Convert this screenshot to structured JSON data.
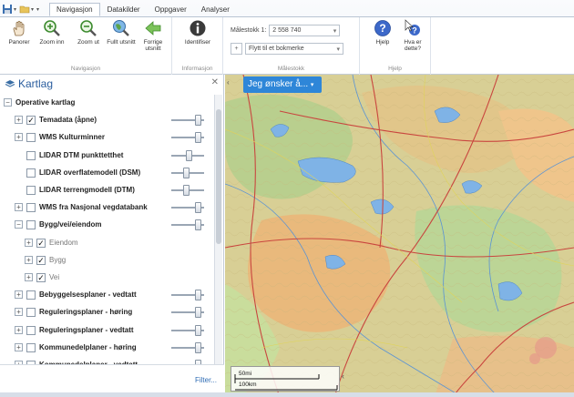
{
  "tabs": [
    "Navigasjon",
    "Datakilder",
    "Oppgaver",
    "Analyser"
  ],
  "ribbon": {
    "nav_buttons": [
      "Panorer",
      "Zoom inn",
      "Zoom ut",
      "Fullt utsnitt",
      "Forrige utsnitt"
    ],
    "nav_group": "Navigasjon",
    "info_button": "Identifiser",
    "info_group": "Informasjon",
    "scale_label": "Målestokk 1:",
    "scale_value": "2 558 740",
    "bookmark_placeholder": "Flytt til et bokmerke",
    "scale_group": "Målestokk",
    "help_button": "Hjelp",
    "whatis_button": "Hva er dette?",
    "help_group": "Hjelp"
  },
  "sidebar": {
    "title": "Kartlag",
    "root": "Operative kartlag",
    "layers": [
      {
        "label": "Temadata (åpne)",
        "checked": true,
        "expander": "+",
        "slider": 0.9
      },
      {
        "label": "WMS Kulturminner",
        "checked": false,
        "expander": "+",
        "slider": 0.9
      },
      {
        "label": "LIDAR DTM punkttetthet",
        "checked": false,
        "expander": "",
        "slider": 0.55
      },
      {
        "label": "LIDAR overflatemodell (DSM)",
        "checked": false,
        "expander": "",
        "slider": 0.45
      },
      {
        "label": "LIDAR terrengmodell (DTM)",
        "checked": false,
        "expander": "",
        "slider": 0.45
      },
      {
        "label": "WMS fra Nasjonal vegdatabank",
        "checked": false,
        "expander": "+",
        "slider": 0.9
      },
      {
        "label": "Bygg/vei/eiendom",
        "checked": false,
        "expander": "−",
        "slider": 0.9
      },
      {
        "label": "Eiendom",
        "checked": true,
        "expander": "+",
        "sub": true
      },
      {
        "label": "Bygg",
        "checked": true,
        "expander": "+",
        "sub": true
      },
      {
        "label": "Vei",
        "checked": true,
        "expander": "+",
        "sub": true
      },
      {
        "label": "Bebyggelsesplaner - vedtatt",
        "checked": false,
        "expander": "+",
        "slider": 0.9
      },
      {
        "label": "Reguleringsplaner - høring",
        "checked": false,
        "expander": "+",
        "slider": 0.9
      },
      {
        "label": "Reguleringsplaner - vedtatt",
        "checked": false,
        "expander": "+",
        "slider": 0.9
      },
      {
        "label": "Kommunedelplaner - høring",
        "checked": false,
        "expander": "+",
        "slider": 0.9
      },
      {
        "label": "Kommunedelplaner - vedtatt",
        "checked": false,
        "expander": "+",
        "slider": 0.9
      }
    ],
    "filter_link": "Filter..."
  },
  "map": {
    "dropdown": "Jeg ønsker å...",
    "scale_mi": "50mi",
    "scale_km": "100km"
  }
}
